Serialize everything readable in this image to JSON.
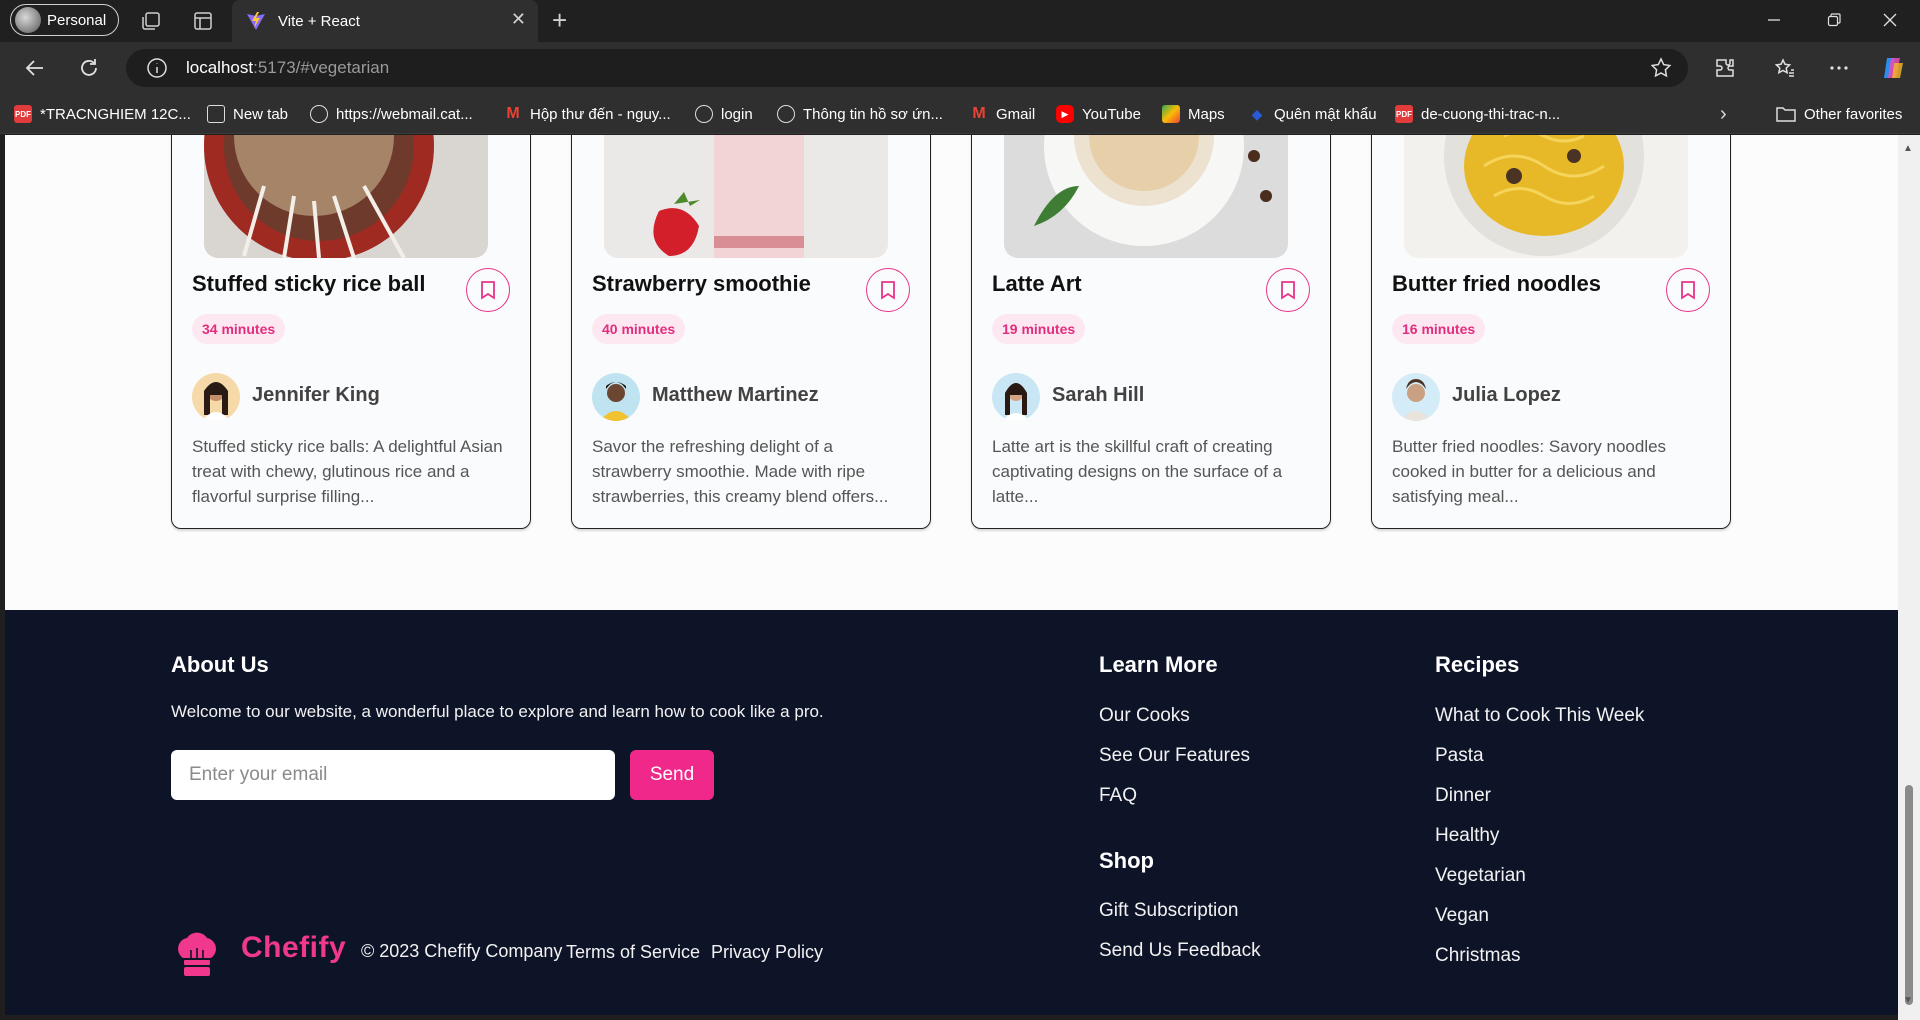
{
  "browser": {
    "profile_label": "Personal",
    "tab_title": "Vite + React",
    "url_host": "localhost",
    "url_path": ":5173/#vegetarian",
    "bookmarks": [
      {
        "label": "*TRACNGHIEM 12C...",
        "icon": "pdf-icon"
      },
      {
        "label": "New tab",
        "icon": "newtab-icon"
      },
      {
        "label": "https://webmail.cat...",
        "icon": "globe-icon"
      },
      {
        "label": "Hộp thư đến - nguy...",
        "icon": "gmail-icon"
      },
      {
        "label": "login",
        "icon": "globe-icon"
      },
      {
        "label": "Thông tin hồ sơ ứn...",
        "icon": "globe-icon"
      },
      {
        "label": "Gmail",
        "icon": "gmail-icon"
      },
      {
        "label": "YouTube",
        "icon": "youtube-icon"
      },
      {
        "label": "Maps",
        "icon": "maps-icon"
      },
      {
        "label": "Quên mật khẩu",
        "icon": "shield-icon"
      },
      {
        "label": "de-cuong-thi-trac-n...",
        "icon": "pdf-icon"
      }
    ],
    "other_favorites": "Other favorites"
  },
  "cards": [
    {
      "title": "Stuffed sticky rice ball",
      "time": "34 minutes",
      "author": "Jennifer King",
      "desc": "Stuffed sticky rice balls: A delightful Asian treat with chewy, glutinous rice and a flavorful surprise filling..."
    },
    {
      "title": "Strawberry smoothie",
      "time": "40 minutes",
      "author": "Matthew Martinez",
      "desc": "Savor the refreshing delight of a strawberry smoothie. Made with ripe strawberries, this creamy blend offers..."
    },
    {
      "title": "Latte Art",
      "time": "19 minutes",
      "author": "Sarah Hill",
      "desc": "Latte art is the skillful craft of creating captivating designs on the surface of a latte..."
    },
    {
      "title": "Butter fried noodles",
      "time": "16 minutes",
      "author": "Julia Lopez",
      "desc": "Butter fried noodles: Savory noodles cooked in butter for a delicious and satisfying meal..."
    }
  ],
  "footer": {
    "about_title": "About Us",
    "about_text": "Welcome to our website, a wonderful place to explore and learn how to cook like a pro.",
    "email_placeholder": "Enter your email",
    "send_label": "Send",
    "learn_more": {
      "title": "Learn More",
      "links": [
        "Our Cooks",
        "See Our Features",
        "FAQ"
      ]
    },
    "shop": {
      "title": "Shop",
      "links": [
        "Gift Subscription",
        "Send Us Feedback"
      ]
    },
    "recipes": {
      "title": "Recipes",
      "links": [
        "What to Cook This Week",
        "Pasta",
        "Dinner",
        "Healthy",
        "Vegetarian",
        "Vegan",
        "Christmas"
      ]
    },
    "brand": "Chefify",
    "copyright": "© 2023 Chefify Company",
    "terms": "Terms of Service",
    "privacy": "Privacy Policy"
  },
  "colors": {
    "accent": "#f0288a",
    "footer_bg": "#0e1428",
    "tag_bg": "#fde8f1"
  }
}
